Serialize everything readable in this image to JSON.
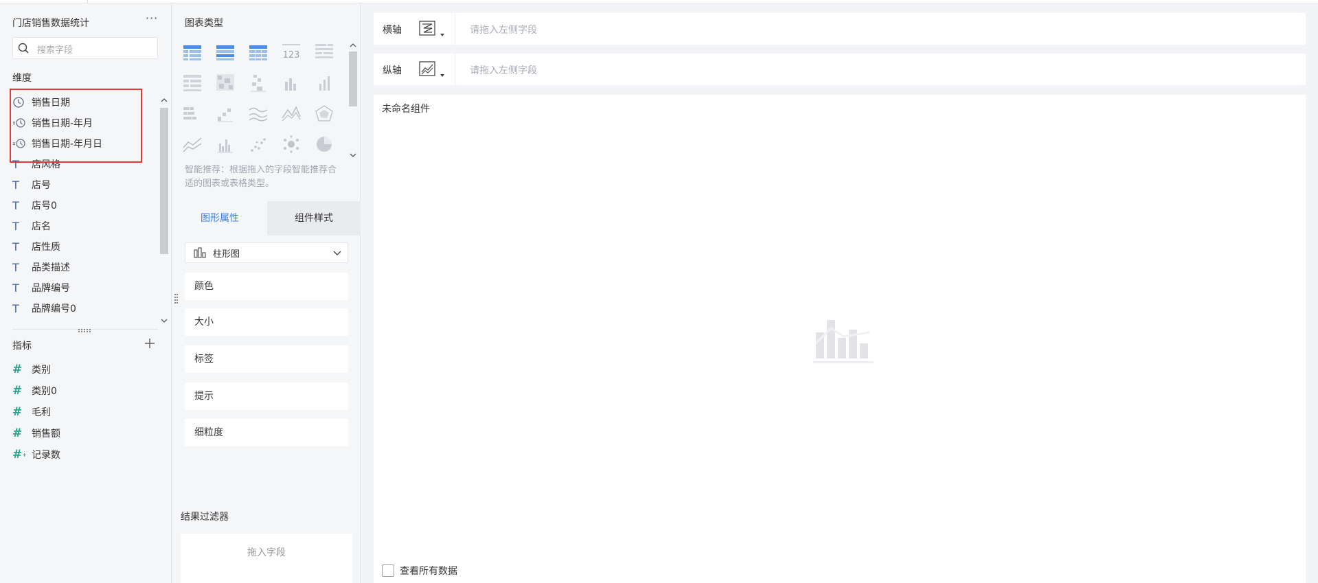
{
  "datasource": {
    "title": "门店销售数据统计",
    "more": "···"
  },
  "search": {
    "placeholder": "搜索字段"
  },
  "dimensions": {
    "label": "维度",
    "items": [
      {
        "label": "销售日期",
        "icon": "clock-icon"
      },
      {
        "label": "销售日期-年月",
        "icon": "derived-clock-icon"
      },
      {
        "label": "销售日期-年月日",
        "icon": "derived-clock-icon"
      },
      {
        "label": "店风格",
        "icon": "text-type-icon"
      },
      {
        "label": "店号",
        "icon": "text-type-icon"
      },
      {
        "label": "店号0",
        "icon": "text-type-icon"
      },
      {
        "label": "店名",
        "icon": "text-type-icon"
      },
      {
        "label": "店性质",
        "icon": "text-type-icon"
      },
      {
        "label": "品类描述",
        "icon": "text-type-icon"
      },
      {
        "label": "品牌编号",
        "icon": "text-type-icon"
      },
      {
        "label": "品牌编号0",
        "icon": "text-type-icon"
      }
    ]
  },
  "metrics": {
    "label": "指标",
    "items": [
      {
        "label": "类别",
        "icon": "number-type-icon"
      },
      {
        "label": "类别0",
        "icon": "number-type-icon"
      },
      {
        "label": "毛利",
        "icon": "number-type-icon"
      },
      {
        "label": "销售额",
        "icon": "number-type-icon"
      },
      {
        "label": "记录数",
        "icon": "record-count-icon"
      }
    ]
  },
  "chart_panel": {
    "title": "图表类型",
    "smart_hint": "智能推荐：根据拖入的字段智能推荐合适的图表或表格类型。",
    "tabs": {
      "active": "图形属性",
      "inactive": "组件样式"
    },
    "chart_type": "柱形图",
    "properties": [
      "颜色",
      "大小",
      "标签",
      "提示",
      "细粒度"
    ],
    "filter_title": "结果过滤器",
    "filter_placeholder": "拖入字段",
    "number_icon_text": "123"
  },
  "axes": {
    "x_label": "横轴",
    "y_label": "纵轴",
    "x_placeholder": "请拖入左侧字段",
    "y_placeholder": "请拖入左侧字段"
  },
  "canvas": {
    "component_name": "未命名组件",
    "view_all": "查看所有数据"
  },
  "colors": {
    "accent": "#3b7de8",
    "highlight_box": "#e53935",
    "number_icon": "#29a38a",
    "text_icon": "#4d6aa0"
  }
}
